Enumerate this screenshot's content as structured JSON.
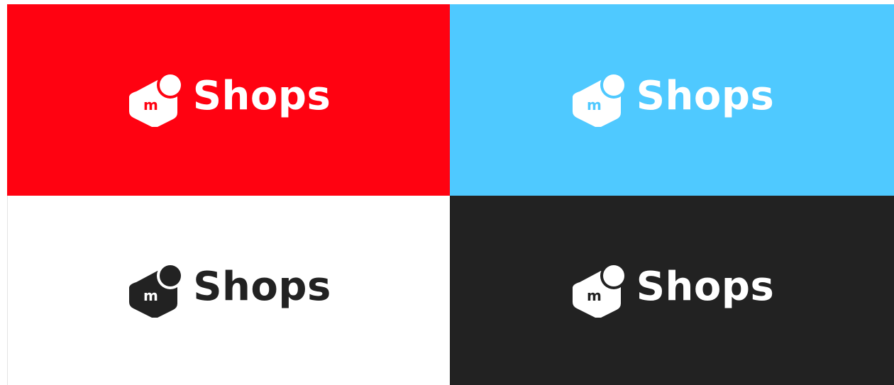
{
  "brand": {
    "wordmark": "Shops",
    "icon": "mercari-box-icon",
    "icon_letter": "m"
  },
  "variants": [
    {
      "name": "red",
      "background": "#FF0211",
      "foreground": "#FFFFFF",
      "letter_color": "#FF0211"
    },
    {
      "name": "blue",
      "background": "#4FC9FF",
      "foreground": "#FFFFFF",
      "letter_color": "#4FC9FF"
    },
    {
      "name": "white",
      "background": "#FFFFFF",
      "foreground": "#222222",
      "letter_color": "#FFFFFF"
    },
    {
      "name": "dark",
      "background": "#222222",
      "foreground": "#FFFFFF",
      "letter_color": "#222222"
    }
  ]
}
